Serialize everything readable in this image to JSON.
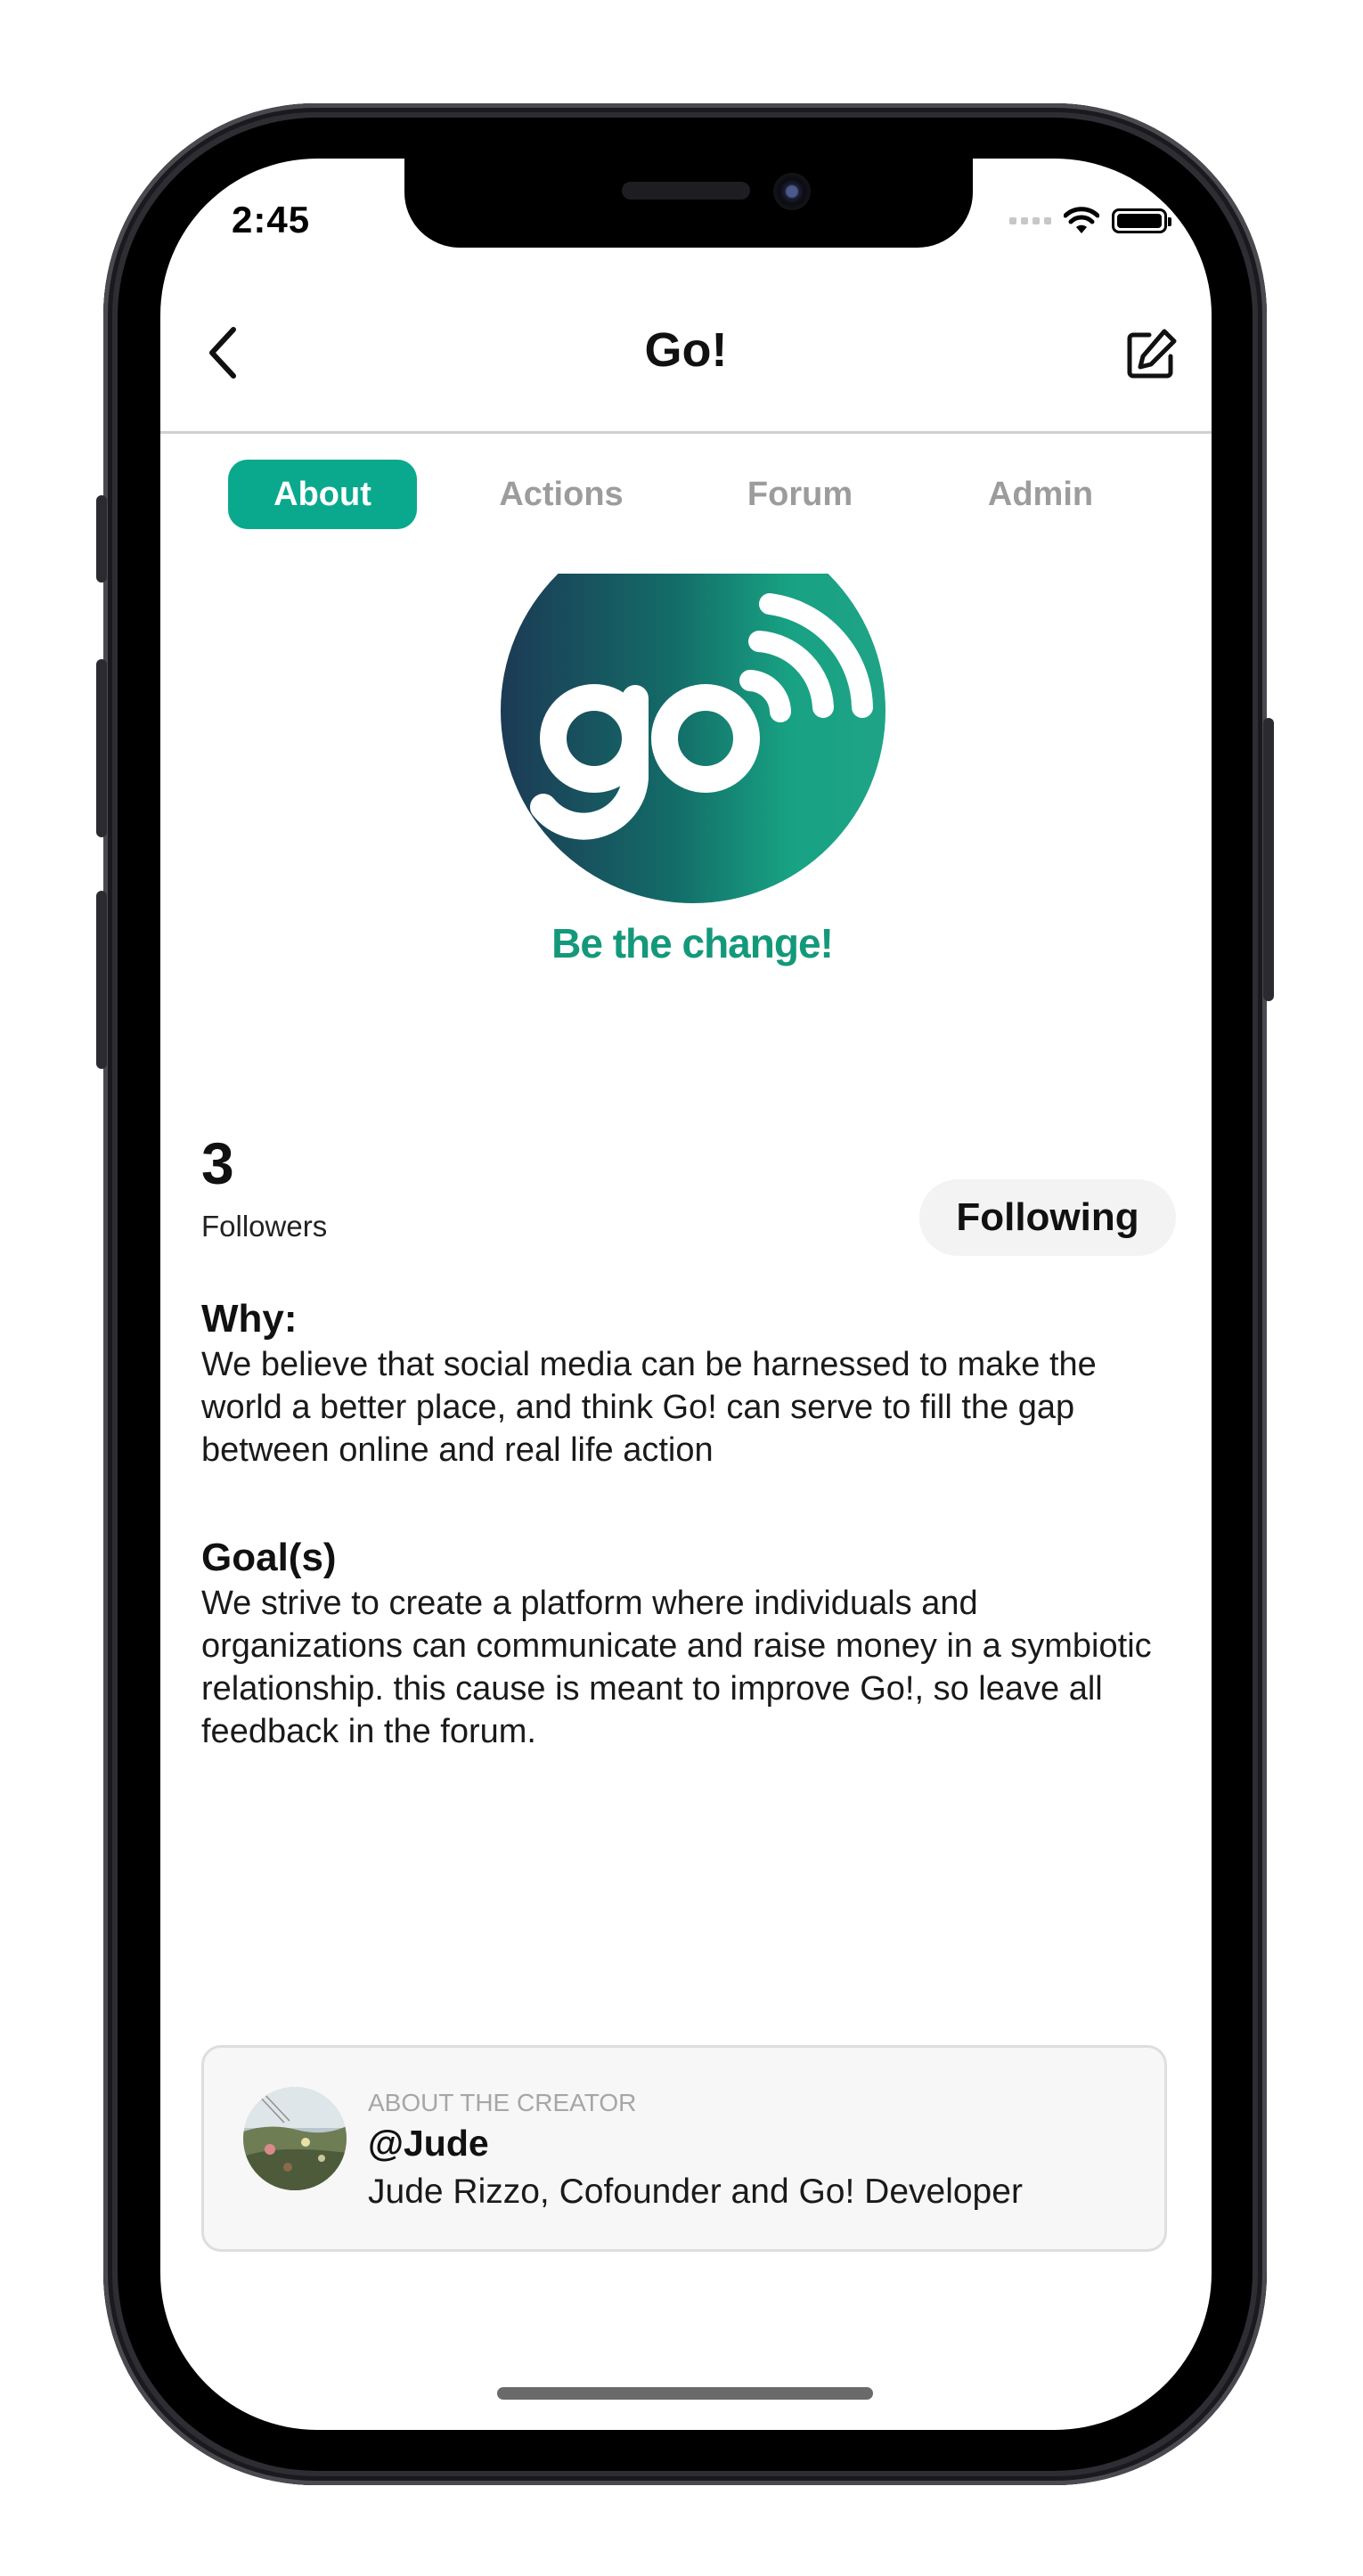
{
  "status_bar": {
    "time": "2:45"
  },
  "nav": {
    "title": "Go!"
  },
  "tabs": [
    {
      "label": "About",
      "active": true
    },
    {
      "label": "Actions",
      "active": false
    },
    {
      "label": "Forum",
      "active": false
    },
    {
      "label": "Admin",
      "active": false
    }
  ],
  "logo": {
    "tagline": "Be the change!"
  },
  "followers": {
    "count": "3",
    "label": "Followers",
    "follow_button": "Following"
  },
  "why": {
    "title": "Why:",
    "body": "We believe that social media can be harnessed to make the world a better place, and think Go! can serve to fill the gap between online and real life action"
  },
  "goals": {
    "title": "Goal(s)",
    "body": "We strive to create a platform where individuals and organizations can communicate and raise money in a symbiotic relationship. this cause is meant to improve Go!, so leave all feedback in the forum."
  },
  "creator": {
    "caption": "ABOUT THE CREATOR",
    "handle": "@Jude",
    "bio": "Jude Rizzo, Cofounder and Go! Developer"
  },
  "colors": {
    "accent": "#0aa98d",
    "logo_dark": "#1c3a55",
    "logo_light": "#18a283"
  }
}
